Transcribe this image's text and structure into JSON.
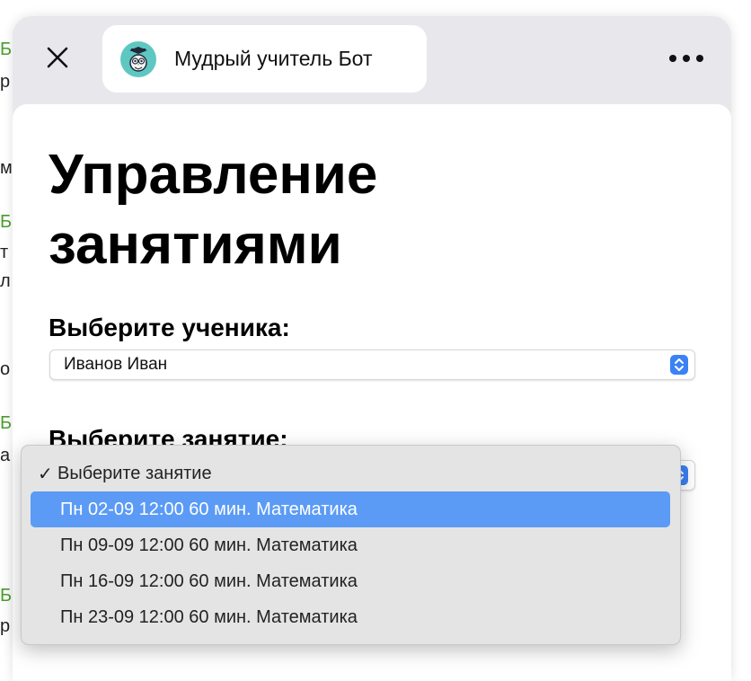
{
  "background_fragments": [
    "Б",
    "р",
    "м",
    "Б",
    "т",
    "л",
    "о",
    "Б",
    "а",
    "Б",
    "р"
  ],
  "header": {
    "bot_name": "Мудрый учитель Бот",
    "icons": {
      "close": "close-icon",
      "more": "more-icon",
      "avatar": "owl-avatar-icon"
    }
  },
  "page": {
    "title_line1": "Управление",
    "title_line2": "занятиями"
  },
  "student": {
    "label": "Выберите ученика:",
    "value": "Иванов Иван"
  },
  "lesson": {
    "label": "Выберите занятие:",
    "options": [
      {
        "label": "Выберите занятие",
        "checked": true
      },
      {
        "label": "Пн 02-09 12:00 60 мин. Математика",
        "highlighted": true
      },
      {
        "label": "Пн 09-09 12:00 60 мин. Математика"
      },
      {
        "label": "Пн 16-09 12:00 60 мин. Математика"
      },
      {
        "label": "Пн 23-09 12:00 60 мин. Математика"
      }
    ]
  },
  "colors": {
    "accent": "#3b82f6",
    "highlight": "#5b9bf5",
    "avatar_bg": "#5fc7c2",
    "sheet_bg": "#e8e8ec"
  }
}
